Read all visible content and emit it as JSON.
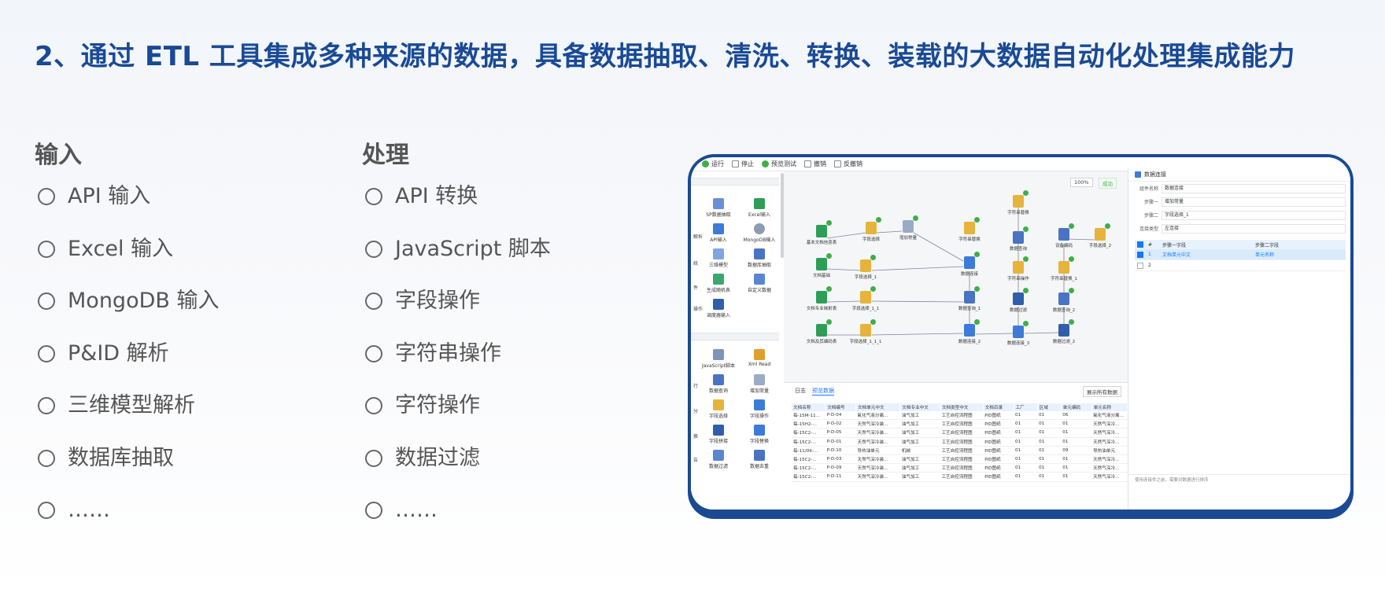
{
  "title": "2、通过 ETL 工具集成多种来源的数据，具备数据抽取、清洗、转换、装载的大数据自动化处理集成能力",
  "columns": {
    "input": {
      "heading": "输入",
      "items": [
        "API 输入",
        "Excel 输入",
        "MongoDB 输入",
        "P&ID 解析",
        "三维模型解析",
        "数据库抽取",
        "……"
      ]
    },
    "process": {
      "heading": "处理",
      "items": [
        "API 转换",
        "JavaScript 脚本",
        "字段操作",
        "字符串操作",
        "字符操作",
        "数据过滤",
        "……"
      ]
    }
  },
  "app": {
    "toolbar": [
      "运行",
      "停止",
      "预览测试",
      "撤销",
      "反撤销"
    ],
    "palette": {
      "edges": [
        "解析",
        "统",
        "件",
        "操作",
        "行",
        "分",
        "换",
        "告"
      ],
      "items": [
        "SP数据抽取",
        "Excel输入",
        "API输入",
        "MongoDB输入",
        "三维模型",
        "数据库抽取",
        "生成随机表",
        "自定义数据",
        "调度器输入",
        "JavaScript脚本",
        "Xml Read",
        "数据查询",
        "增加常量",
        "字段选择",
        "字段操作",
        "字段拼接",
        "字段替换",
        "数据过滤",
        "数据去重",
        "调度"
      ]
    },
    "canvas": {
      "buttons": [
        "100%",
        "成功"
      ],
      "nodes": [
        "基本文档信息表",
        "字段选择",
        "增加常量",
        "字符串替换",
        "文档基础",
        "字段选择_1",
        "设备编码",
        "数据查询",
        "字段选择_2",
        "文档专业映射表",
        "字段选择_1_1",
        "数据查询_1",
        "字符串操作",
        "数据过滤",
        "文档及其编码表",
        "字段选择_1_1_1",
        "数据连接_2",
        "数据连接",
        "字符串替换_1",
        "数据连接_3",
        "数据查询_2",
        "数据过滤_2",
        "字符串替换"
      ]
    },
    "results": {
      "tabs": [
        "日志",
        "预览数据"
      ],
      "button": "展示所有数据",
      "columns": [
        "文档名称",
        "文档编号",
        "文档单元中文",
        "文档专业中文",
        "文档类型中文",
        "文档目录",
        "工厂",
        "区域",
        "单元编码",
        "单元名称"
      ],
      "rows": [
        [
          "每-15M-11...",
          "P-D-04",
          "氧化气液分离...",
          "油气加工",
          "工艺自控流程图",
          "PID图纸",
          "01",
          "01",
          "06",
          "氧化气液分离..."
        ],
        [
          "每-15H2-...",
          "P-D-02",
          "天然气深冷装...",
          "油气加工",
          "工艺自控流程图",
          "PID图纸",
          "01",
          "01",
          "01",
          "天然气深冷..."
        ],
        [
          "每-15C2-...",
          "P-D-05",
          "天然气深冷装...",
          "油气加工",
          "工艺自控流程图",
          "PID图纸",
          "01",
          "01",
          "01",
          "天然气深冷..."
        ],
        [
          "每-15C2-...",
          "P-D-01",
          "天然气深冷装...",
          "油气加工",
          "工艺自控流程图",
          "PID图纸",
          "01",
          "01",
          "01",
          "天然气深冷..."
        ],
        [
          "每-11/09-...",
          "P-D-10",
          "导热油单元",
          "机械",
          "工艺自控流程图",
          "PID图纸",
          "01",
          "01",
          "09",
          "导热油单元"
        ],
        [
          "每-15C2-...",
          "P-D-03",
          "天然气深冷装...",
          "油气加工",
          "工艺自控流程图",
          "PID图纸",
          "01",
          "01",
          "01",
          "天然气深冷..."
        ],
        [
          "每-15C2-...",
          "P-D-09",
          "天然气深冷装...",
          "油气加工",
          "工艺自控流程图",
          "PID图纸",
          "01",
          "01",
          "01",
          "天然气深冷..."
        ],
        [
          "每-15C2-...",
          "P-D-11",
          "天然气深冷装...",
          "油气加工",
          "工艺自控流程图",
          "PID图纸",
          "01",
          "01",
          "01",
          "天然气深冷..."
        ]
      ]
    },
    "props": {
      "title": "数据连接",
      "fields": [
        {
          "label": "组件名称",
          "value": "数据连接"
        },
        {
          "label": "步骤一",
          "value": "增加常量"
        },
        {
          "label": "步骤二",
          "value": "字段选择_1"
        },
        {
          "label": "连接类型",
          "value": "左连接"
        }
      ],
      "table_head": [
        "#",
        "步骤一字段",
        "步骤二字段"
      ],
      "rows": [
        [
          "1",
          "文档单元中文",
          "单元名称"
        ],
        [
          "2",
          "",
          ""
        ]
      ],
      "hint": "使用连接件之前，需要对数据进行排序"
    }
  },
  "colors": {
    "title": "#1a4a96",
    "frame": "#1b4a93",
    "accent": "#1677ff",
    "success": "#3fae49"
  }
}
